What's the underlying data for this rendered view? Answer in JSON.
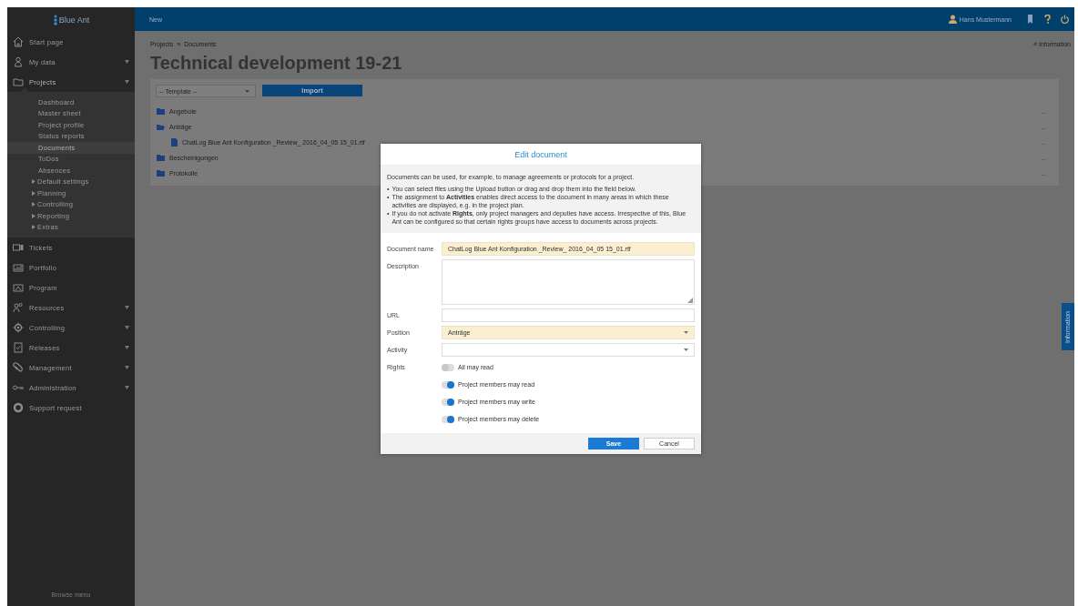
{
  "sidebar": {
    "logo": "Blue Ant",
    "items": [
      {
        "label": "Start page",
        "expandable": false,
        "expanded": false
      },
      {
        "label": "My data",
        "expandable": true,
        "expanded": false
      },
      {
        "label": "Projects",
        "expandable": true,
        "expanded": true,
        "children": [
          {
            "label": "Dashboard",
            "expandable": false,
            "selected": false
          },
          {
            "label": "Master sheet",
            "expandable": false,
            "selected": false
          },
          {
            "label": "Project profile",
            "expandable": false,
            "selected": false
          },
          {
            "label": "Status reports",
            "expandable": false,
            "selected": false
          },
          {
            "label": "Documents",
            "expandable": false,
            "selected": true
          },
          {
            "label": "ToDos",
            "expandable": false,
            "selected": false
          },
          {
            "label": "Absences",
            "expandable": false,
            "selected": false
          },
          {
            "label": "Default settings",
            "expandable": true,
            "selected": false
          },
          {
            "label": "Planning",
            "expandable": true,
            "selected": false
          },
          {
            "label": "Controlling",
            "expandable": true,
            "selected": false
          },
          {
            "label": "Reporting",
            "expandable": true,
            "selected": false
          },
          {
            "label": "Extras",
            "expandable": true,
            "selected": false
          }
        ]
      },
      {
        "label": "Tickets",
        "expandable": false,
        "expanded": false
      },
      {
        "label": "Portfolio",
        "expandable": false,
        "expanded": false
      },
      {
        "label": "Program",
        "expandable": false,
        "expanded": false
      },
      {
        "label": "Resources",
        "expandable": true,
        "expanded": false
      },
      {
        "label": "Controlling",
        "expandable": true,
        "expanded": false
      },
      {
        "label": "Releases",
        "expandable": true,
        "expanded": false
      },
      {
        "label": "Management",
        "expandable": true,
        "expanded": false
      },
      {
        "label": "Administration",
        "expandable": true,
        "expanded": false
      },
      {
        "label": "Support request",
        "expandable": false,
        "expanded": false
      }
    ],
    "footer": "Browse menu"
  },
  "top_bar": {
    "new_label": "New",
    "user": "Hans Mustermann"
  },
  "breadcrumb": [
    "Projects",
    "»",
    "Documents"
  ],
  "info_link": "« Information",
  "page_title": "Technical development 19-21",
  "toolbar": {
    "template_placeholder": "-- Template --",
    "import_button": "Import"
  },
  "tree": [
    {
      "label": "Angebote",
      "kind": "folder",
      "expanded": false,
      "more": "..."
    },
    {
      "label": "Anträge",
      "kind": "folder",
      "expanded": true,
      "more": "...",
      "children": [
        {
          "label": "ChatLog Blue Ant Konfiguration _Review_ 2016_04_05 15_01.rtf",
          "kind": "file",
          "more": "..."
        }
      ]
    },
    {
      "label": "Bescheinigungen",
      "kind": "folder",
      "expanded": false,
      "more": "..."
    },
    {
      "label": "Protokolle",
      "kind": "folder",
      "expanded": false,
      "more": "..."
    }
  ],
  "side_tab": "Information",
  "dialog": {
    "title": "Edit document",
    "intro": "Documents can be used, for example, to manage agreements or protocols for a project.",
    "bullets": [
      {
        "marker": "•",
        "text": "You can select files using the Upload button or drag and drop them into the field below."
      },
      {
        "marker": "•",
        "text": "The assignment to **Activities** enables direct access to the document in many areas in which these activities are displayed, e.g. in the project plan."
      },
      {
        "marker": "•",
        "text": "If you do not activate **Rights**, only project managers and deputies have access. Irrespective of this, Blue Ant can be configured so that certain rights groups have access to documents across projects."
      }
    ],
    "fields": [
      {
        "label": "Document name",
        "kind": "text",
        "value": "ChatLog Blue Ant Konfiguration _Review_ 2016_04_05 15_01.rtf",
        "required": true
      },
      {
        "label": "Description",
        "kind": "textarea",
        "required": false
      },
      {
        "label": "URL",
        "kind": "text",
        "required": false
      },
      {
        "label": "Position",
        "kind": "select",
        "value": "Anträge",
        "required": true
      },
      {
        "label": "Activity",
        "kind": "select",
        "required": false
      }
    ],
    "rights_label": "Rights",
    "rights": [
      {
        "label": "All may read",
        "on": false
      },
      {
        "label": "Project members may read",
        "on": true
      },
      {
        "label": "Project members may write",
        "on": true
      },
      {
        "label": "Project members may delete",
        "on": true
      }
    ],
    "buttons": [
      {
        "label": "Save",
        "primary": true
      },
      {
        "label": "Cancel",
        "primary": false
      }
    ]
  }
}
